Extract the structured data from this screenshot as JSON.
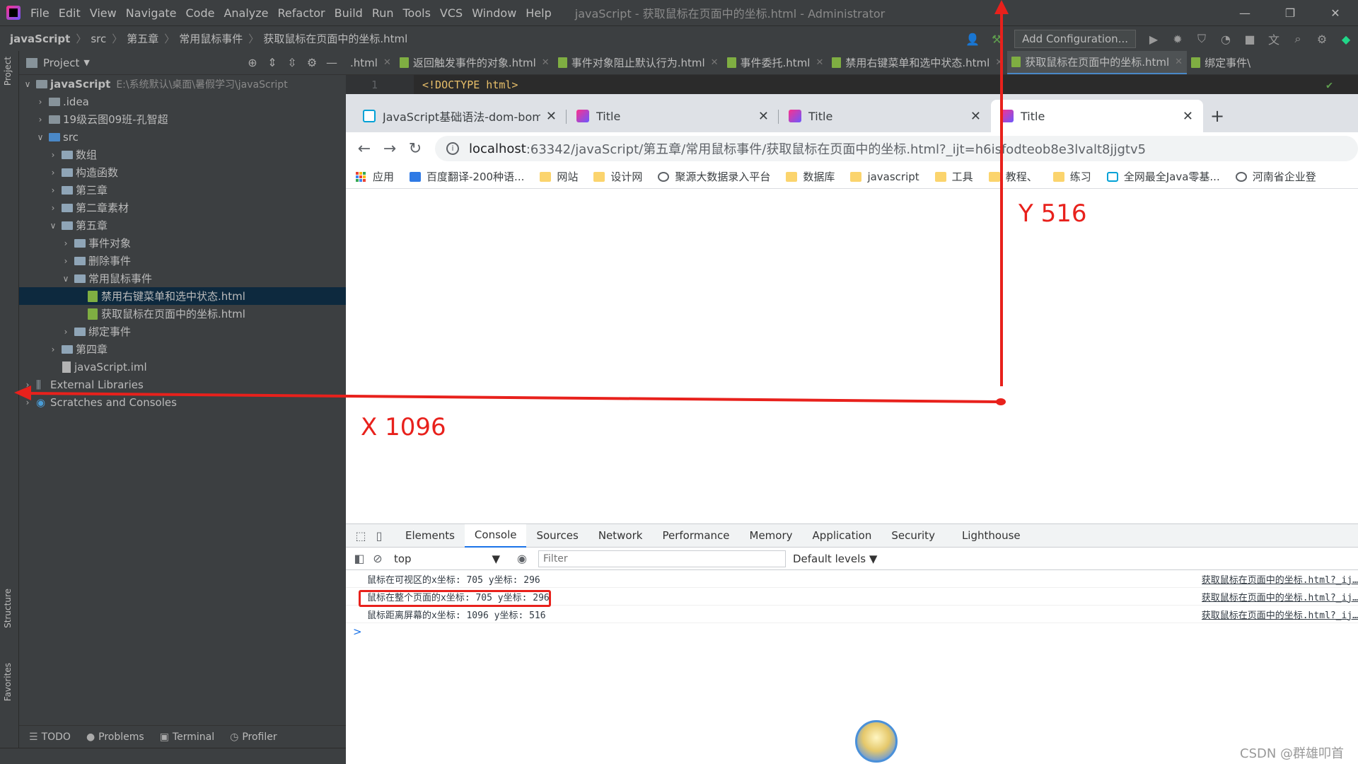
{
  "ide": {
    "menu": [
      "File",
      "Edit",
      "View",
      "Navigate",
      "Code",
      "Analyze",
      "Refactor",
      "Build",
      "Run",
      "Tools",
      "VCS",
      "Window",
      "Help"
    ],
    "window_title": "javaScript - 获取鼠标在页面中的坐标.html - Administrator",
    "breadcrumbs": [
      "javaScript",
      "src",
      "第五章",
      "常用鼠标事件",
      "获取鼠标在页面中的坐标.html"
    ],
    "add_configuration": "Add Configuration...",
    "left_strip": {
      "project": "Project",
      "structure": "Structure",
      "favorites": "Favorites"
    },
    "project_panel": {
      "title": "Project",
      "tree": [
        {
          "label": "javaScript",
          "hint": "E:\\系统默认\\桌面\\暑假学习\\javaScript"
        },
        {
          "label": ".idea"
        },
        {
          "label": "19级云图09班-孔智超"
        },
        {
          "label": "src"
        },
        {
          "label": "数组"
        },
        {
          "label": "构造函数"
        },
        {
          "label": "第三章"
        },
        {
          "label": "第二章素材"
        },
        {
          "label": "第五章"
        },
        {
          "label": "事件对象"
        },
        {
          "label": "删除事件"
        },
        {
          "label": "常用鼠标事件"
        },
        {
          "label": "禁用右键菜单和选中状态.html"
        },
        {
          "label": "获取鼠标在页面中的坐标.html"
        },
        {
          "label": "绑定事件"
        },
        {
          "label": "第四章"
        },
        {
          "label": "javaScript.iml"
        },
        {
          "label": "External Libraries"
        },
        {
          "label": "Scratches and Consoles"
        }
      ]
    },
    "bottom_tools": [
      "TODO",
      "Problems",
      "Terminal",
      "Profiler"
    ],
    "editor_tabs": [
      ".html",
      "返回触发事件的对象.html",
      "事件对象阻止默认行为.html",
      "事件委托.html",
      "禁用右键菜单和选中状态.html",
      "获取鼠标在页面中的坐标.html",
      "绑定事件\\"
    ],
    "editor": {
      "line_number": "1",
      "code": "<!DOCTYPE html>"
    }
  },
  "browser": {
    "tabs": [
      {
        "label": "JavaScript基础语法-dom-bom-"
      },
      {
        "label": "Title"
      },
      {
        "label": "Title"
      },
      {
        "label": "Title"
      }
    ],
    "url_host": "localhost",
    "url_rest": ":63342/javaScript/第五章/常用鼠标事件/获取鼠标在页面中的坐标.html?_ijt=h6isfodteob8e3lvalt8jjgtv5",
    "bookmarks": [
      {
        "label": "应用",
        "icon": "apps"
      },
      {
        "label": "百度翻译-200种语...",
        "icon": "trans"
      },
      {
        "label": "网站",
        "icon": "folder"
      },
      {
        "label": "设计网",
        "icon": "folder"
      },
      {
        "label": "聚源大数据录入平台",
        "icon": "globe"
      },
      {
        "label": "数据库",
        "icon": "folder"
      },
      {
        "label": "javascript",
        "icon": "folder"
      },
      {
        "label": "工具",
        "icon": "folder"
      },
      {
        "label": "教程、",
        "icon": "folder"
      },
      {
        "label": "练习",
        "icon": "folder"
      },
      {
        "label": "全网最全Java零基...",
        "icon": "bili"
      },
      {
        "label": "河南省企业登",
        "icon": "globe"
      }
    ],
    "devtools": {
      "tabs": [
        "Elements",
        "Console",
        "Sources",
        "Network",
        "Performance",
        "Memory",
        "Application",
        "Security",
        "Lighthouse"
      ],
      "context": "top",
      "filter_placeholder": "Filter",
      "levels": "Default levels ▼",
      "console_lines": [
        {
          "msg": "鼠标在可视区的x坐标: 705 y坐标: 296",
          "src": "获取鼠标在页面中的坐标.html?_ij…"
        },
        {
          "msg": "鼠标在整个页面的x坐标: 705 y坐标: 296",
          "src": "获取鼠标在页面中的坐标.html?_ij…"
        },
        {
          "msg": "鼠标距离屏幕的x坐标: 1096 y坐标: 516",
          "src": "获取鼠标在页面中的坐标.html?_ij…"
        }
      ],
      "prompt": ">"
    }
  },
  "annotations": {
    "y_label": "Y 516",
    "x_label": "X 1096",
    "color": "#e8211c"
  },
  "watermark": "CSDN @群雄叩首"
}
